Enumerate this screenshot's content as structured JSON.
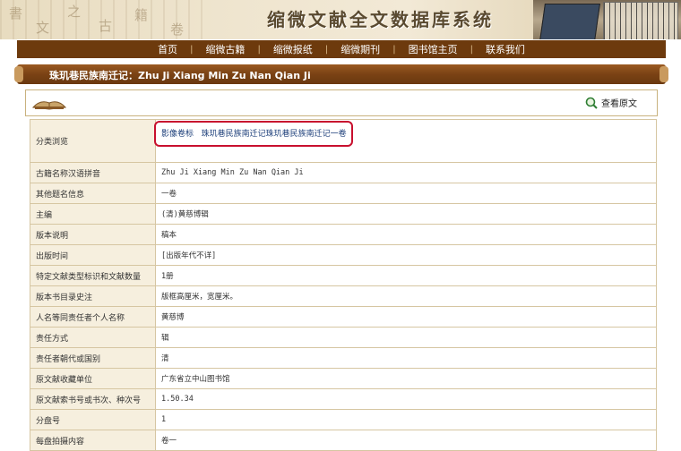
{
  "banner": {
    "title": "缩微文献全文数据库系统"
  },
  "nav": {
    "items": [
      "首页",
      "缩微古籍",
      "缩微报纸",
      "缩微期刊",
      "图书馆主页",
      "联系我们"
    ]
  },
  "record": {
    "title": "珠玑巷民族南迁记：Zhu Ji Xiang Min Zu Nan Qian Ji"
  },
  "toolbar": {
    "view_original": "查看原文"
  },
  "category": {
    "label": "分类浏览",
    "path": [
      "影像卷标",
      "珠玑巷民族南迁记珠玑巷民族南迁记一卷"
    ]
  },
  "fields": [
    {
      "label": "古籍名称汉语拼音",
      "value": "Zhu Ji Xiang Min Zu Nan Qian Ji"
    },
    {
      "label": "其他题名信息",
      "value": "一卷"
    },
    {
      "label": "主编",
      "value": "(清)黄慈博辑"
    },
    {
      "label": "版本说明",
      "value": "稿本"
    },
    {
      "label": "出版时间",
      "value": "[出版年代不详]"
    },
    {
      "label": "特定文献类型标识和文献数量",
      "value": "1册"
    },
    {
      "label": "版本书目录史注",
      "value": "版框高厘米，宽厘米。"
    },
    {
      "label": "人名等同责任者个人名称",
      "value": "黄慈博"
    },
    {
      "label": "责任方式",
      "value": "辑"
    },
    {
      "label": "责任者朝代或国别",
      "value": "清"
    },
    {
      "label": "原文献收藏单位",
      "value": "广东省立中山图书馆"
    },
    {
      "label": "原文献索书号或书次、种次号",
      "value": "1.50.34"
    },
    {
      "label": "分盘号",
      "value": "1"
    },
    {
      "label": "每盘拍摄内容",
      "value": "卷一"
    }
  ]
}
